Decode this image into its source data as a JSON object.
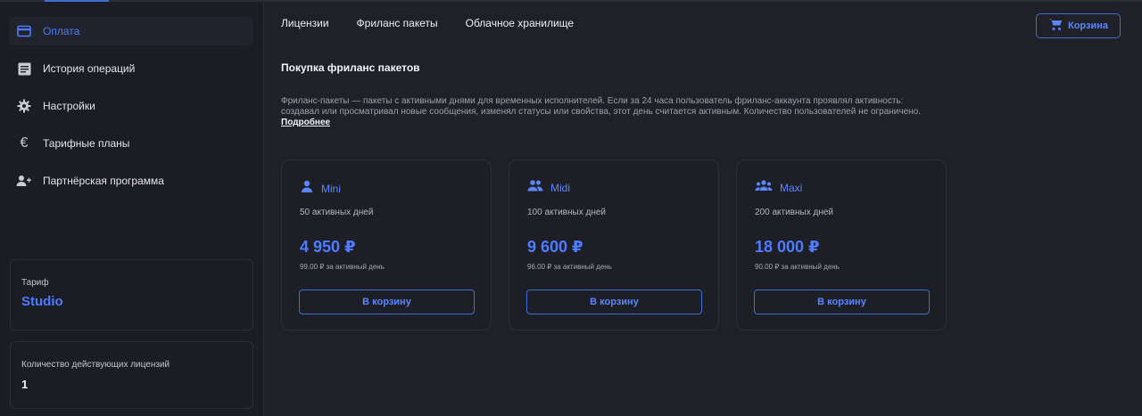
{
  "sidebar": {
    "items": [
      {
        "label": "Оплата",
        "icon": "credit-card-icon",
        "active": true
      },
      {
        "label": "История операций",
        "icon": "receipt-icon",
        "active": false
      },
      {
        "label": "Настройки",
        "icon": "gear-icon",
        "active": false
      },
      {
        "label": "Тарифные планы",
        "icon": "euro-icon",
        "active": false
      },
      {
        "label": "Партнёрская программа",
        "icon": "add-user-icon",
        "active": false
      }
    ],
    "tariff": {
      "caption": "Тариф",
      "value": "Studio"
    },
    "licenses": {
      "caption": "Количество действующих лицензий",
      "value": "1"
    }
  },
  "header": {
    "tabs": [
      {
        "label": "Лицензии"
      },
      {
        "label": "Фриланс пакеты"
      },
      {
        "label": "Облачное хранилище"
      }
    ],
    "cart_label": "Корзина"
  },
  "main": {
    "title": "Покупка фриланс пакетов",
    "description": "Фриланс-пакеты — пакеты с активными днями для временных исполнителей. Если за 24 часа пользователь фриланс-аккаунта проявлял активность: создавал или просматривал новые сообщения, изменял статусы или свойства, этот день считается активным. Количество пользователей не ограничено.",
    "more_link": "Подробнее",
    "packages": [
      {
        "name": "Mini",
        "icon": "person-icon",
        "days": "50 активных дней",
        "price": "4 950 ₽",
        "per_day": "99.00 ₽ за активный день",
        "button": "В корзину"
      },
      {
        "name": "Midi",
        "icon": "people-icon",
        "days": "100 активных дней",
        "price": "9 600 ₽",
        "per_day": "96.00 ₽ за активный день",
        "button": "В корзину"
      },
      {
        "name": "Maxi",
        "icon": "group-icon",
        "days": "200 активных дней",
        "price": "18 000 ₽",
        "per_day": "90.00 ₽ за активный день",
        "button": "В корзину"
      }
    ]
  },
  "colors": {
    "accent": "#4e7bff",
    "background": "#1f2028",
    "sidebar": "#1c1d24",
    "border": "#2d2f38"
  }
}
